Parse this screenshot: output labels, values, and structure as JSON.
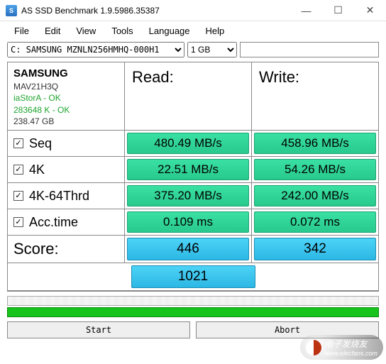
{
  "window": {
    "title": "AS SSD Benchmark 1.9.5986.35387"
  },
  "menu": {
    "file": "File",
    "edit": "Edit",
    "view": "View",
    "tools": "Tools",
    "language": "Language",
    "help": "Help"
  },
  "toolbar": {
    "drive": "C: SAMSUNG MZNLN256HMHQ-000H1",
    "size": "1 GB"
  },
  "drive_info": {
    "vendor": "SAMSUNG",
    "model": "MAV21H3Q",
    "driver": "iaStorA - OK",
    "alignment": "283648 K - OK",
    "capacity": "238.47 GB"
  },
  "headers": {
    "read": "Read:",
    "write": "Write:"
  },
  "tests": {
    "seq": {
      "label": "Seq",
      "read": "480.49 MB/s",
      "write": "458.96 MB/s"
    },
    "fk": {
      "label": "4K",
      "read": "22.51 MB/s",
      "write": "54.26 MB/s"
    },
    "fk64": {
      "label": "4K-64Thrd",
      "read": "375.20 MB/s",
      "write": "242.00 MB/s"
    },
    "acc": {
      "label": "Acc.time",
      "read": "0.109 ms",
      "write": "0.072 ms"
    }
  },
  "score": {
    "label": "Score:",
    "read": "446",
    "write": "342",
    "total": "1021"
  },
  "buttons": {
    "start": "Start",
    "abort": "Abort"
  },
  "watermark": {
    "text": "电子发烧友",
    "url": "www.elecfans.com"
  }
}
